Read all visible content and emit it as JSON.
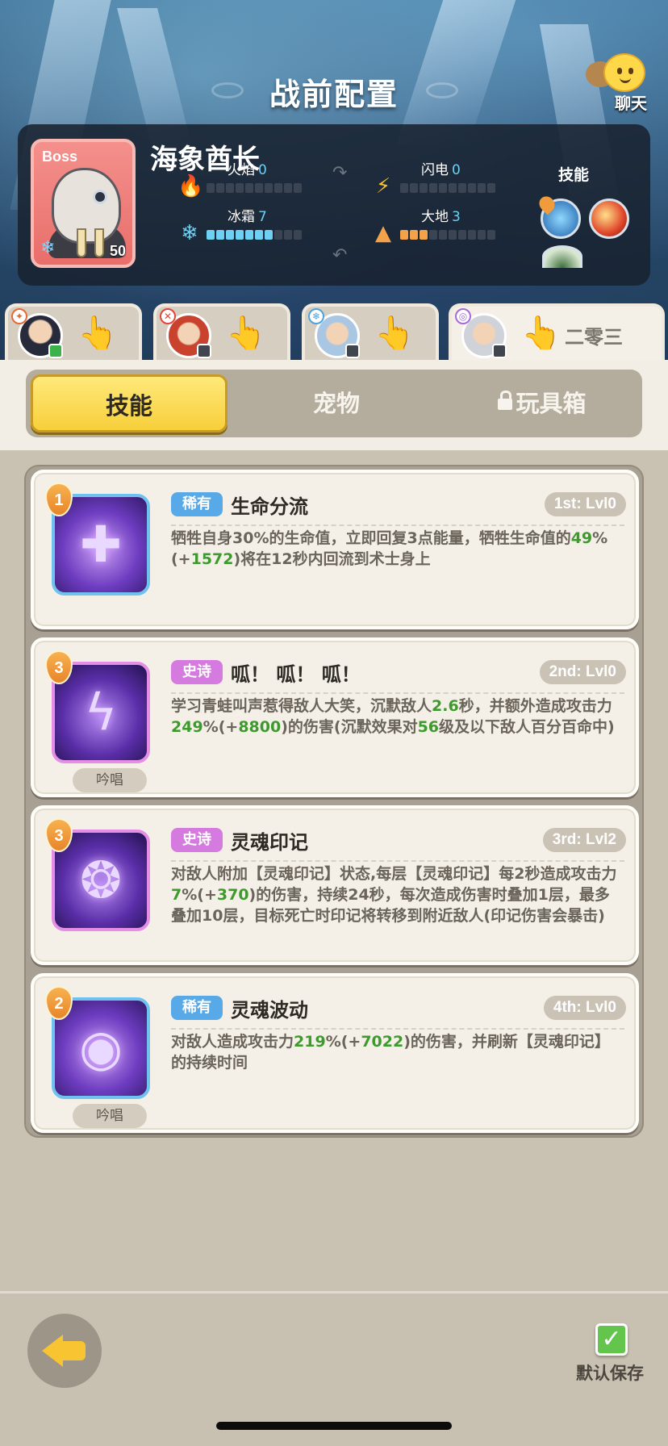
{
  "header": {
    "title": "战前配置",
    "chat_label": "聊天"
  },
  "boss": {
    "tag": "Boss",
    "name": "海象酋长",
    "level": "50",
    "skills_label": "技能",
    "stats": [
      {
        "name": "火焰",
        "value": "0",
        "icon": "fire-icon",
        "level": 0,
        "color": "#e4553a"
      },
      {
        "name": "闪电",
        "value": "0",
        "icon": "lightning-icon",
        "level": 0,
        "color": "#f6c235"
      },
      {
        "name": "冰霜",
        "value": "7",
        "icon": "frost-icon",
        "level": 7,
        "color": "#6ed0f2"
      },
      {
        "name": "大地",
        "value": "3",
        "icon": "earth-icon",
        "level": 3,
        "color": "#f4a24a"
      }
    ]
  },
  "team_tabs": [
    {
      "elem": "fire",
      "active": false
    },
    {
      "elem": "fire",
      "active": false
    },
    {
      "elem": "ice",
      "active": false
    },
    {
      "elem": "shadow",
      "active": true,
      "name": "二零三"
    }
  ],
  "segments": {
    "skills": "技能",
    "pets": "宠物",
    "toybox": "玩具箱",
    "active": "skills"
  },
  "skills": [
    {
      "rank": "1",
      "rarity": "稀有",
      "name": "生命分流",
      "slot": "1st: Lvl0",
      "chant": "",
      "desc": [
        {
          "t": "牺牲自身30%的生命值，立即回复3点能量，牺牲生命值的"
        },
        {
          "t": "49",
          "g": true
        },
        {
          "t": "%(+"
        },
        {
          "t": "1572",
          "g": true
        },
        {
          "t": ")将在12秒内回流到术士身上"
        }
      ]
    },
    {
      "rank": "3",
      "rarity": "史诗",
      "name": "呱！ 呱！ 呱！",
      "slot": "2nd: Lvl0",
      "chant": "吟唱",
      "desc": [
        {
          "t": "学习青蛙叫声惹得敌人大笑，沉默敌人"
        },
        {
          "t": "2.6",
          "g": true
        },
        {
          "t": "秒，并额外造成攻击力"
        },
        {
          "t": "249",
          "g": true
        },
        {
          "t": "%(+"
        },
        {
          "t": "8800",
          "g": true
        },
        {
          "t": ")的伤害(沉默效果对"
        },
        {
          "t": "56",
          "g": true
        },
        {
          "t": "级及以下敌人百分百命中)"
        }
      ]
    },
    {
      "rank": "3",
      "rarity": "史诗",
      "name": "灵魂印记",
      "slot": "3rd: Lvl2",
      "chant": "",
      "desc": [
        {
          "t": "对敌人附加【灵魂印记】状态,每层【灵魂印记】每2秒造成攻击力"
        },
        {
          "t": "7",
          "g": true
        },
        {
          "t": "%(+"
        },
        {
          "t": "370",
          "g": true
        },
        {
          "t": ")的伤害，持续24秒，每次造成伤害时叠加1层，最多叠加10层，目标死亡时印记将转移到附近敌人(印记伤害会暴击)"
        }
      ]
    },
    {
      "rank": "2",
      "rarity": "稀有",
      "name": "灵魂波动",
      "slot": "4th: Lvl0",
      "chant": "吟唱",
      "desc": [
        {
          "t": "对敌人造成攻击力"
        },
        {
          "t": "219",
          "g": true
        },
        {
          "t": "%(+"
        },
        {
          "t": "7022",
          "g": true
        },
        {
          "t": ")的伤害，并刷新【灵魂印记】的持续时间"
        }
      ]
    }
  ],
  "footer": {
    "save_label": "默认保存"
  }
}
